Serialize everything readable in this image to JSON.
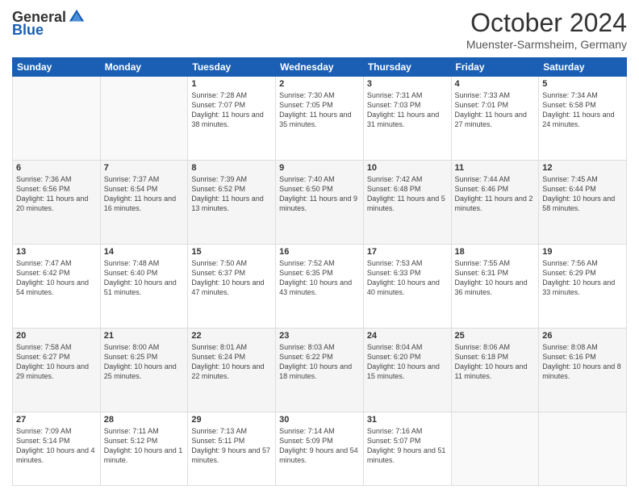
{
  "header": {
    "logo": {
      "general": "General",
      "blue": "Blue"
    },
    "title": "October 2024",
    "location": "Muenster-Sarmsheim, Germany"
  },
  "weekdays": [
    "Sunday",
    "Monday",
    "Tuesday",
    "Wednesday",
    "Thursday",
    "Friday",
    "Saturday"
  ],
  "weeks": [
    [
      {
        "day": "",
        "info": ""
      },
      {
        "day": "",
        "info": ""
      },
      {
        "day": "1",
        "sunrise": "7:28 AM",
        "sunset": "7:07 PM",
        "daylight": "11 hours and 38 minutes."
      },
      {
        "day": "2",
        "sunrise": "7:30 AM",
        "sunset": "7:05 PM",
        "daylight": "11 hours and 35 minutes."
      },
      {
        "day": "3",
        "sunrise": "7:31 AM",
        "sunset": "7:03 PM",
        "daylight": "11 hours and 31 minutes."
      },
      {
        "day": "4",
        "sunrise": "7:33 AM",
        "sunset": "7:01 PM",
        "daylight": "11 hours and 27 minutes."
      },
      {
        "day": "5",
        "sunrise": "7:34 AM",
        "sunset": "6:58 PM",
        "daylight": "11 hours and 24 minutes."
      }
    ],
    [
      {
        "day": "6",
        "sunrise": "7:36 AM",
        "sunset": "6:56 PM",
        "daylight": "11 hours and 20 minutes."
      },
      {
        "day": "7",
        "sunrise": "7:37 AM",
        "sunset": "6:54 PM",
        "daylight": "11 hours and 16 minutes."
      },
      {
        "day": "8",
        "sunrise": "7:39 AM",
        "sunset": "6:52 PM",
        "daylight": "11 hours and 13 minutes."
      },
      {
        "day": "9",
        "sunrise": "7:40 AM",
        "sunset": "6:50 PM",
        "daylight": "11 hours and 9 minutes."
      },
      {
        "day": "10",
        "sunrise": "7:42 AM",
        "sunset": "6:48 PM",
        "daylight": "11 hours and 5 minutes."
      },
      {
        "day": "11",
        "sunrise": "7:44 AM",
        "sunset": "6:46 PM",
        "daylight": "11 hours and 2 minutes."
      },
      {
        "day": "12",
        "sunrise": "7:45 AM",
        "sunset": "6:44 PM",
        "daylight": "10 hours and 58 minutes."
      }
    ],
    [
      {
        "day": "13",
        "sunrise": "7:47 AM",
        "sunset": "6:42 PM",
        "daylight": "10 hours and 54 minutes."
      },
      {
        "day": "14",
        "sunrise": "7:48 AM",
        "sunset": "6:40 PM",
        "daylight": "10 hours and 51 minutes."
      },
      {
        "day": "15",
        "sunrise": "7:50 AM",
        "sunset": "6:37 PM",
        "daylight": "10 hours and 47 minutes."
      },
      {
        "day": "16",
        "sunrise": "7:52 AM",
        "sunset": "6:35 PM",
        "daylight": "10 hours and 43 minutes."
      },
      {
        "day": "17",
        "sunrise": "7:53 AM",
        "sunset": "6:33 PM",
        "daylight": "10 hours and 40 minutes."
      },
      {
        "day": "18",
        "sunrise": "7:55 AM",
        "sunset": "6:31 PM",
        "daylight": "10 hours and 36 minutes."
      },
      {
        "day": "19",
        "sunrise": "7:56 AM",
        "sunset": "6:29 PM",
        "daylight": "10 hours and 33 minutes."
      }
    ],
    [
      {
        "day": "20",
        "sunrise": "7:58 AM",
        "sunset": "6:27 PM",
        "daylight": "10 hours and 29 minutes."
      },
      {
        "day": "21",
        "sunrise": "8:00 AM",
        "sunset": "6:25 PM",
        "daylight": "10 hours and 25 minutes."
      },
      {
        "day": "22",
        "sunrise": "8:01 AM",
        "sunset": "6:24 PM",
        "daylight": "10 hours and 22 minutes."
      },
      {
        "day": "23",
        "sunrise": "8:03 AM",
        "sunset": "6:22 PM",
        "daylight": "10 hours and 18 minutes."
      },
      {
        "day": "24",
        "sunrise": "8:04 AM",
        "sunset": "6:20 PM",
        "daylight": "10 hours and 15 minutes."
      },
      {
        "day": "25",
        "sunrise": "8:06 AM",
        "sunset": "6:18 PM",
        "daylight": "10 hours and 11 minutes."
      },
      {
        "day": "26",
        "sunrise": "8:08 AM",
        "sunset": "6:16 PM",
        "daylight": "10 hours and 8 minutes."
      }
    ],
    [
      {
        "day": "27",
        "sunrise": "7:09 AM",
        "sunset": "5:14 PM",
        "daylight": "10 hours and 4 minutes."
      },
      {
        "day": "28",
        "sunrise": "7:11 AM",
        "sunset": "5:12 PM",
        "daylight": "10 hours and 1 minute."
      },
      {
        "day": "29",
        "sunrise": "7:13 AM",
        "sunset": "5:11 PM",
        "daylight": "9 hours and 57 minutes."
      },
      {
        "day": "30",
        "sunrise": "7:14 AM",
        "sunset": "5:09 PM",
        "daylight": "9 hours and 54 minutes."
      },
      {
        "day": "31",
        "sunrise": "7:16 AM",
        "sunset": "5:07 PM",
        "daylight": "9 hours and 51 minutes."
      },
      {
        "day": "",
        "info": ""
      },
      {
        "day": "",
        "info": ""
      }
    ]
  ]
}
